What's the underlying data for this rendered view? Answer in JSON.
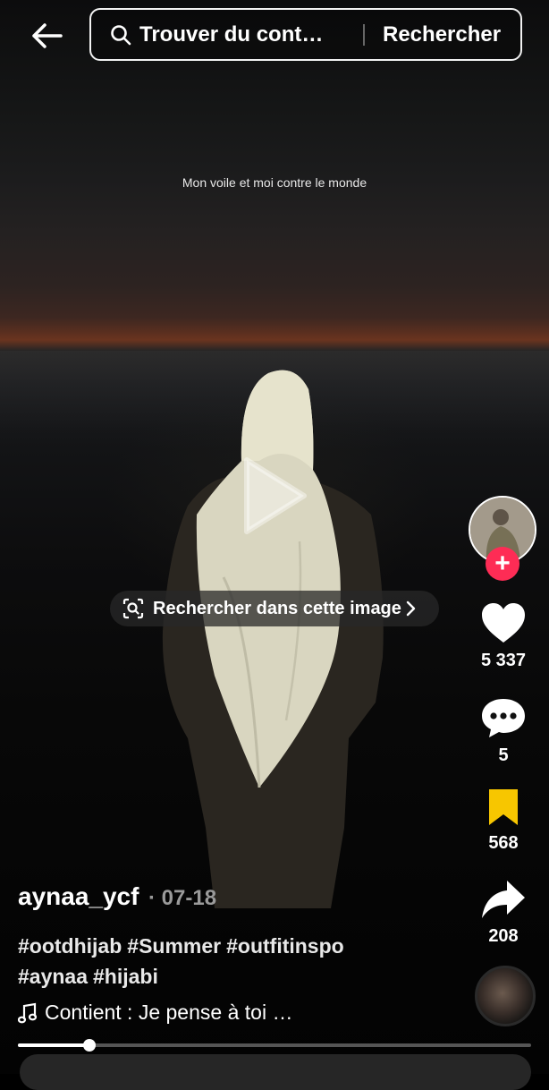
{
  "topbar": {
    "search_placeholder": "Trouver du cont…",
    "search_button": "Rechercher"
  },
  "video": {
    "overlay_text": "Mon voile et moi contre le monde",
    "image_search_label": "Rechercher dans cette image",
    "progress": 0.14
  },
  "rail": {
    "likes": "5 337",
    "comments": "5",
    "saves": "568",
    "shares": "208"
  },
  "post": {
    "username": "aynaa_ycf",
    "date": "· 07-18",
    "hashtags": [
      "#ootdhijab",
      "#Summer",
      "#outfitinspo",
      "#aynaa",
      "#hijabi"
    ],
    "music": "Contient : Je pense à toi …"
  },
  "colors": {
    "follow": "#fe2c55",
    "bookmark": "#f7c600"
  }
}
